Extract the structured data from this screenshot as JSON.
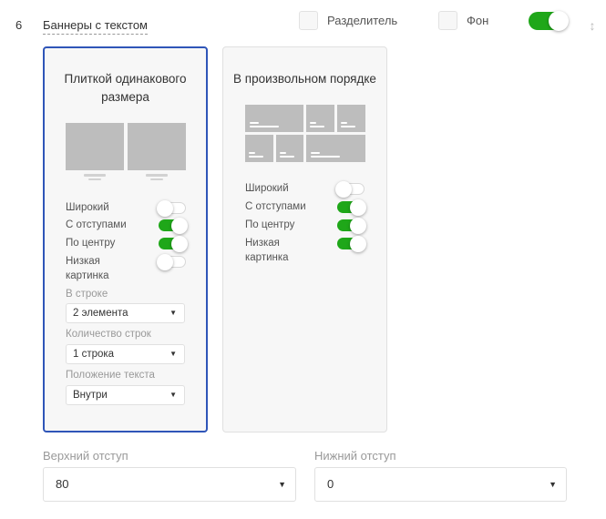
{
  "row": {
    "number": "6",
    "title": "Баннеры с текстом"
  },
  "header": {
    "divider_label": "Разделитель",
    "background_label": "Фон",
    "enabled": true
  },
  "cards": [
    {
      "title": "Плиткой одинакового размера",
      "selected": true,
      "options": [
        {
          "label": "Широкий",
          "on": false
        },
        {
          "label": "С отступами",
          "on": true
        },
        {
          "label": "По центру",
          "on": true
        },
        {
          "label": "Низкая картинка",
          "on": false
        }
      ],
      "per_row_label": "В строке",
      "per_row_value": "2 элемента",
      "rows_label": "Количество строк",
      "rows_value": "1 строка",
      "text_pos_label": "Положение текста",
      "text_pos_value": "Внутри"
    },
    {
      "title": "В произвольном порядке",
      "selected": false,
      "options": [
        {
          "label": "Широкий",
          "on": false
        },
        {
          "label": "С отступами",
          "on": true
        },
        {
          "label": "По центру",
          "on": true
        },
        {
          "label": "Низкая картинка",
          "on": true
        }
      ]
    }
  ],
  "padding": {
    "top_label": "Верхний отступ",
    "top_value": "80",
    "bottom_label": "Нижний отступ",
    "bottom_value": "0"
  },
  "colors": {
    "accent": "#2f55b8",
    "toggle_on": "#1fa719",
    "placeholder": "#bdbdbd"
  }
}
